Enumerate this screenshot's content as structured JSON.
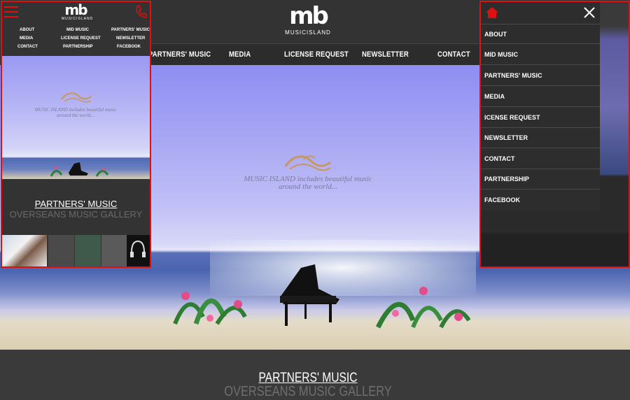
{
  "logo": {
    "mark": "mb",
    "text": "MUSICISLAND"
  },
  "desktop_nav": [
    "PARTNERS' MUSIC",
    "MEDIA",
    "LICENSE REQUEST",
    "NEWSLETTER",
    "CONTACT"
  ],
  "hero": {
    "tagline_line1": "MUSIC ISLAND includes beautiful music",
    "tagline_line2": "around the world..."
  },
  "section": {
    "title": "PARTNERS' MUSIC",
    "subtitle": "OVERSEANS MUSIC GALLERY"
  },
  "mobile_nav": {
    "row1": [
      "ABOUT",
      "MID MUSIC",
      "PARTNERS' MUSIC"
    ],
    "row2": [
      "MEDIA",
      "LICENSE REQUEST",
      "NEWSLETTER"
    ],
    "row3": [
      "CONTACT",
      "PARTNERSHIP",
      "FACEBOOK"
    ]
  },
  "menu_items": [
    "ABOUT",
    "MID MUSIC",
    "PARTNERS' MUSIC",
    "MEDIA",
    "ICENSE REQUEST",
    "NEWSLETTER",
    "CONTACT",
    "PARTNERSHIP",
    "FACEBOOK"
  ],
  "colors": {
    "accent": "#e01010",
    "header_bg": "#333333",
    "text": "#ffffff",
    "muted": "#6f6f6f"
  },
  "icons": [
    "hamburger-icon",
    "phone-icon",
    "home-icon",
    "close-icon"
  ]
}
